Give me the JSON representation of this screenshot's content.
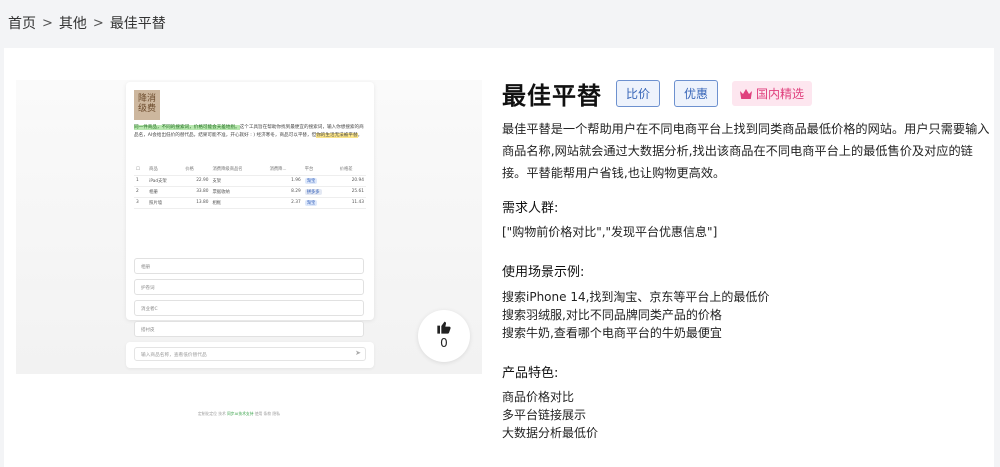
{
  "breadcrumb": {
    "home": "首页",
    "sep1": ">",
    "category": "其他",
    "sep2": ">",
    "current": "最佳平替"
  },
  "preview": {
    "logo": "降消\n级费",
    "intro_green": "同一件商品，不同的搜索词，价格可能会天差地别。",
    "intro_rest": "这个工具旨在帮助你找到最便宜的搜索词，输入你想搜索的商品名，AI会给出低价的替代品，结果可能不准，开心就好 : ) 经济寒冬，商品可以平替，但",
    "intro_yellow": "你的生活无法被平替",
    "intro_end": "。",
    "table_headers": [
      "商品",
      "价格",
      "消费降级商品名",
      "消费降...",
      "平台",
      "价格差"
    ],
    "rows": [
      {
        "name": "iPad支架",
        "price": "22.90",
        "alt": "支架",
        "alt_price": "1.96",
        "platform": "淘宝",
        "diff": "20.94"
      },
      {
        "name": "相册",
        "price": "33.80",
        "alt": "票据收纳",
        "alt_price": "8.29",
        "platform": "拼多多",
        "diff": "25.61"
      },
      {
        "name": "照片墙",
        "price": "13.80",
        "alt": "相框",
        "alt_price": "2.37",
        "platform": "淘宝",
        "diff": "11.43"
      }
    ],
    "inputs": [
      "相册",
      "护卷词",
      "消业者C",
      "搭衬皮"
    ],
    "search_placeholder": "输入商品名称，查看低价替代品",
    "footer_a": "定制化定位 技术",
    "footer_b": "同步AI技术支持",
    "footer_c": "使用  条款  隐私"
  },
  "like": {
    "icon": "thumbs-up-icon",
    "count": "0"
  },
  "info": {
    "title": "最佳平替",
    "tags": [
      "比价",
      "优惠"
    ],
    "vip_tag": "国内精选",
    "description": "最佳平替是一个帮助用户在不同电商平台上找到同类商品最低价格的网站。用户只需要输入商品名称,网站就会通过大数据分析,找出该商品在不同电商平台上的最低售价及对应的链接。平替能帮用户省钱,也让购物更高效。",
    "audience_heading": "需求人群:",
    "audience": "[\"购物前价格对比\",\"发现平台优惠信息\"]",
    "scenarios_heading": "使用场景示例:",
    "scenarios": [
      "搜索iPhone 14,找到淘宝、京东等平台上的最低价",
      "搜索羽绒服,对比不同品牌同类产品的价格",
      "搜索牛奶,查看哪个电商平台的牛奶最便宜"
    ],
    "features_heading": "产品特色:",
    "features": [
      "商品价格对比",
      "多平台链接展示",
      "大数据分析最低价"
    ]
  },
  "colors": {
    "accent": "#3866b8",
    "vip": "#e0407d",
    "highlight_green": "#b9e8b0",
    "highlight_yellow": "#fbe58a"
  }
}
